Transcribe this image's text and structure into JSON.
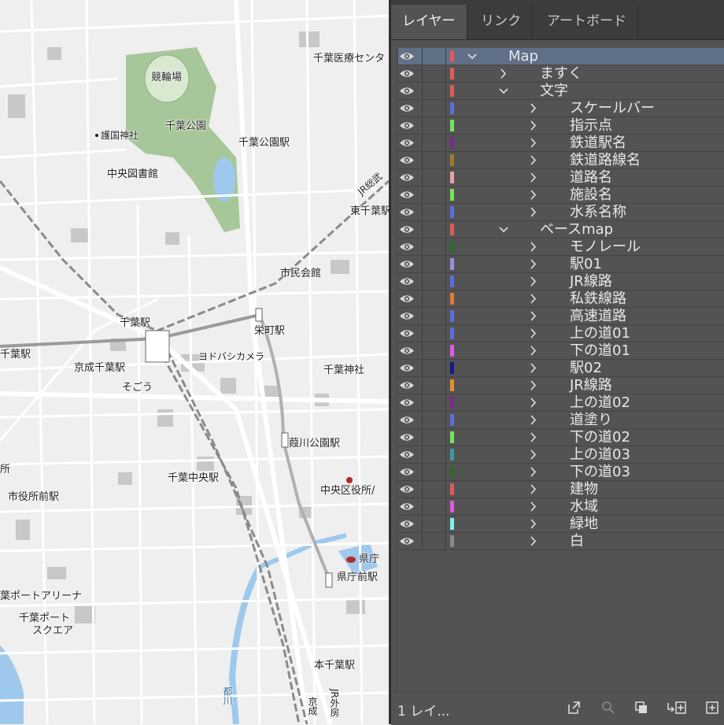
{
  "map": {
    "labels": {
      "keirinjo": "競輪場",
      "gokoku": "護国神社",
      "chiba_park": "千葉公園",
      "chiba_koen_sta": "千葉公園駅",
      "chuo_library": "中央図書館",
      "medical_center": "千葉医療センタ",
      "jr_sobu": "JR総武",
      "higashi_chiba": "東千葉駅",
      "shimin_kaikan": "市民会館",
      "chiba_sta": "千葉駅",
      "sakaecho_sta": "栄町駅",
      "nishi_chiba_sta": "千葉駅",
      "yodobashi": "ヨドバシカメラ",
      "keisei_chiba": "京成千葉駅",
      "sogo": "そごう",
      "chiba_jinja": "千葉神社",
      "kasugawa_sta": "葭川公園駅",
      "chiba_chuo_sta": "千葉中央駅",
      "chuo_ward_office": "中央区役所/",
      "shiyakusho_mae": "市役所前駅",
      "sho": "所",
      "kencho": "県庁",
      "kencho_mae": "県庁前駅",
      "port_arena": "葉ポートアリーナ",
      "port_square_1": "千葉ポート",
      "port_square_2": "スクエア",
      "hon_chiba": "本千葉駅",
      "jr_sotobo": "JR外房",
      "keisei": "京成",
      "miyako": "都川"
    }
  },
  "panel": {
    "tabs": [
      "レイヤー",
      "リンク",
      "アートボード"
    ],
    "layers": [
      {
        "name": "Map",
        "color": "#e05a5a",
        "level": 0,
        "expanded": true,
        "selected": true
      },
      {
        "name": "ますく",
        "color": "#e05a5a",
        "level": 1,
        "expanded": false
      },
      {
        "name": "文字",
        "color": "#e05a5a",
        "level": 1,
        "expanded": true
      },
      {
        "name": "スケールバー",
        "color": "#5a6ee0",
        "level": 2,
        "expanded": false
      },
      {
        "name": "指示点",
        "color": "#79e05a",
        "level": 2,
        "expanded": false
      },
      {
        "name": "鉄道駅名",
        "color": "#7a2a8a",
        "level": 2,
        "expanded": false
      },
      {
        "name": "鉄道路線名",
        "color": "#a0782a",
        "level": 2,
        "expanded": false
      },
      {
        "name": "道路名",
        "color": "#e8a0a8",
        "level": 2,
        "expanded": false
      },
      {
        "name": "施設名",
        "color": "#79e05a",
        "level": 2,
        "expanded": false
      },
      {
        "name": "水系名称",
        "color": "#5a6ee0",
        "level": 2,
        "expanded": false
      },
      {
        "name": "ベースmap",
        "color": "#e05a5a",
        "level": 1,
        "expanded": true
      },
      {
        "name": "モノレール",
        "color": "#2e6a2e",
        "level": 2,
        "expanded": false
      },
      {
        "name": "駅01",
        "color": "#a08ce0",
        "level": 2,
        "expanded": false
      },
      {
        "name": "JR線路",
        "color": "#5a6ee0",
        "level": 2,
        "expanded": false
      },
      {
        "name": "私鉄線路",
        "color": "#e07a3a",
        "level": 2,
        "expanded": false
      },
      {
        "name": "高速道路",
        "color": "#5a6ee0",
        "level": 2,
        "expanded": false
      },
      {
        "name": "上の道01",
        "color": "#5a6ee0",
        "level": 2,
        "expanded": false
      },
      {
        "name": "下の道01",
        "color": "#e05ae0",
        "level": 2,
        "expanded": false
      },
      {
        "name": "駅02",
        "color": "#1a1a8a",
        "level": 2,
        "expanded": false
      },
      {
        "name": "JR線路",
        "color": "#e0902a",
        "level": 2,
        "expanded": false
      },
      {
        "name": "上の道02",
        "color": "#7a2a8a",
        "level": 2,
        "expanded": false
      },
      {
        "name": "道塗り",
        "color": "#5a6ee0",
        "level": 2,
        "expanded": false
      },
      {
        "name": "下の道02",
        "color": "#79e05a",
        "level": 2,
        "expanded": false
      },
      {
        "name": "上の道03",
        "color": "#3a9aa0",
        "level": 2,
        "expanded": false
      },
      {
        "name": "下の道03",
        "color": "#2e6a2e",
        "level": 2,
        "expanded": false
      },
      {
        "name": "建物",
        "color": "#e05a5a",
        "level": 2,
        "expanded": false
      },
      {
        "name": "水域",
        "color": "#e05ae0",
        "level": 2,
        "expanded": false
      },
      {
        "name": "緑地",
        "color": "#7ef0f0",
        "level": 2,
        "expanded": false
      },
      {
        "name": "白",
        "color": "#8a8a8a",
        "level": 2,
        "expanded": false
      }
    ],
    "footer": {
      "count": "1 レイ...",
      "icons": [
        "export-icon",
        "search-icon",
        "clip-mask-icon",
        "new-sublayer-icon",
        "new-layer-icon"
      ]
    }
  }
}
